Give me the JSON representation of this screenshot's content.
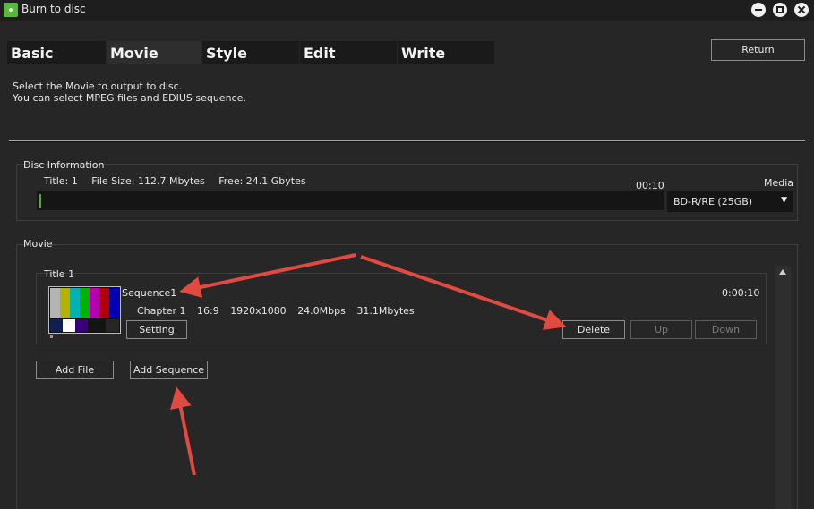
{
  "window": {
    "title": "Burn to disc",
    "controls": [
      "minimize-icon",
      "maximize-icon",
      "close-icon"
    ]
  },
  "tabs": [
    {
      "label": "Basic",
      "active": false
    },
    {
      "label": "Movie",
      "active": true
    },
    {
      "label": "Style",
      "active": false
    },
    {
      "label": "Edit",
      "active": false
    },
    {
      "label": "Write",
      "active": false
    }
  ],
  "return_label": "Return",
  "instructions": {
    "line1": "Select the Movie to output to disc.",
    "line2": "You can select MPEG files and EDIUS sequence."
  },
  "disc_info": {
    "group_label": "Disc Information",
    "title_count": "Title: 1",
    "file_size": "File Size: 112.7 Mbytes",
    "free": "Free: 24.1 Gbytes",
    "time_marker": "00:10",
    "media_label": "Media",
    "media_value": "BD-R/RE (25GB)",
    "usage_fraction": 0.004
  },
  "movie": {
    "group_label": "Movie",
    "title_label": "Title 1",
    "sequence_name": "Sequence1",
    "duration": "0:00:10",
    "chapter": "Chapter 1",
    "aspect": "16:9",
    "resolution": "1920x1080",
    "bitrate": "24.0Mbps",
    "size": "31.1Mbytes",
    "setting_label": "Setting",
    "delete_label": "Delete",
    "up_label": "Up",
    "down_label": "Down",
    "add_file_label": "Add File",
    "add_sequence_label": "Add Sequence"
  },
  "colors": {
    "background": "#262626",
    "titlebar": "#1e1e1e",
    "progress": "#53b02c",
    "annotation_arrow": "#e04a40"
  }
}
